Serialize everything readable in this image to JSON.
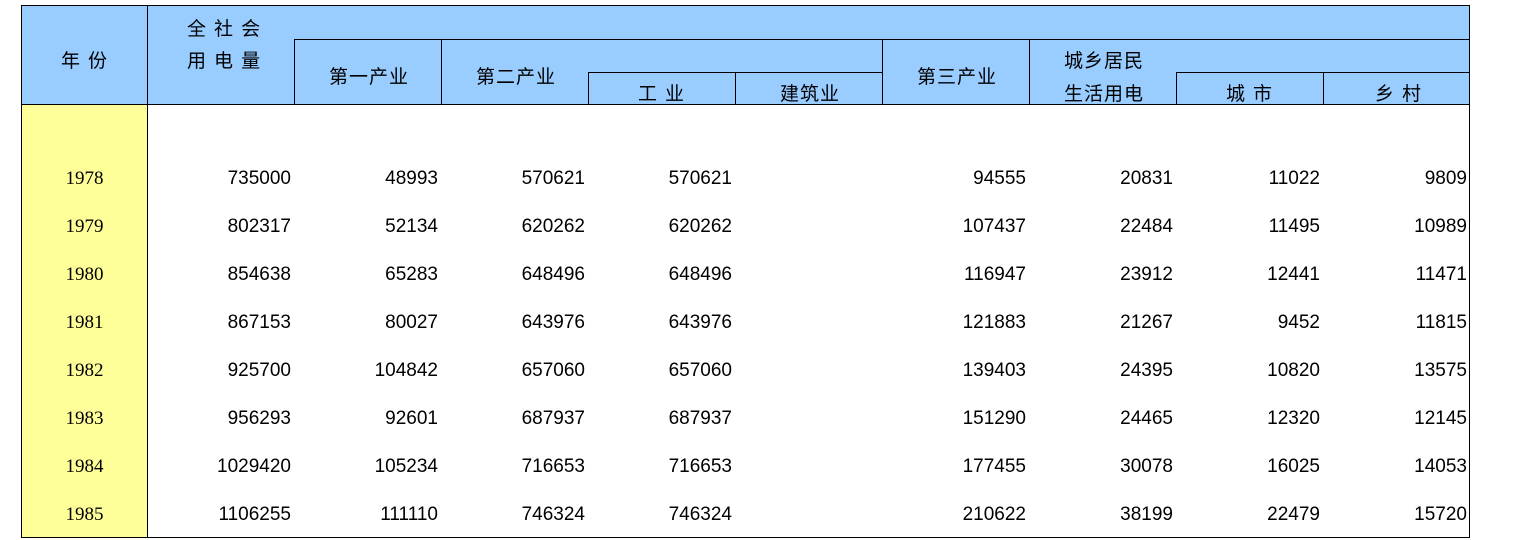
{
  "headers": {
    "year": "年  份",
    "total_line1": "全 社 会",
    "total_line2": "用 电 量",
    "primary": "第一产业",
    "secondary": "第二产业",
    "industry": "工  业",
    "construction": "建筑业",
    "tertiary": "第三产业",
    "residential_line1": "城乡居民",
    "residential_line2": "生活用电",
    "urban": "城  市",
    "rural": "乡  村"
  },
  "rows": [
    {
      "year": "1978",
      "total": "735000",
      "primary": "48993",
      "secondary": "570621",
      "industry": "570621",
      "construction": "",
      "tertiary": "94555",
      "residential": "20831",
      "urban": "11022",
      "rural": "9809"
    },
    {
      "year": "1979",
      "total": "802317",
      "primary": "52134",
      "secondary": "620262",
      "industry": "620262",
      "construction": "",
      "tertiary": "107437",
      "residential": "22484",
      "urban": "11495",
      "rural": "10989"
    },
    {
      "year": "1980",
      "total": "854638",
      "primary": "65283",
      "secondary": "648496",
      "industry": "648496",
      "construction": "",
      "tertiary": "116947",
      "residential": "23912",
      "urban": "12441",
      "rural": "11471"
    },
    {
      "year": "1981",
      "total": "867153",
      "primary": "80027",
      "secondary": "643976",
      "industry": "643976",
      "construction": "",
      "tertiary": "121883",
      "residential": "21267",
      "urban": "9452",
      "rural": "11815"
    },
    {
      "year": "1982",
      "total": "925700",
      "primary": "104842",
      "secondary": "657060",
      "industry": "657060",
      "construction": "",
      "tertiary": "139403",
      "residential": "24395",
      "urban": "10820",
      "rural": "13575"
    },
    {
      "year": "1983",
      "total": "956293",
      "primary": "92601",
      "secondary": "687937",
      "industry": "687937",
      "construction": "",
      "tertiary": "151290",
      "residential": "24465",
      "urban": "12320",
      "rural": "12145"
    },
    {
      "year": "1984",
      "total": "1029420",
      "primary": "105234",
      "secondary": "716653",
      "industry": "716653",
      "construction": "",
      "tertiary": "177455",
      "residential": "30078",
      "urban": "16025",
      "rural": "14053"
    },
    {
      "year": "1985",
      "total": "1106255",
      "primary": "111110",
      "secondary": "746324",
      "industry": "746324",
      "construction": "",
      "tertiary": "210622",
      "residential": "38199",
      "urban": "22479",
      "rural": "15720"
    }
  ],
  "colors": {
    "header_bg": "#99ccff",
    "year_bg": "#ffff99"
  }
}
